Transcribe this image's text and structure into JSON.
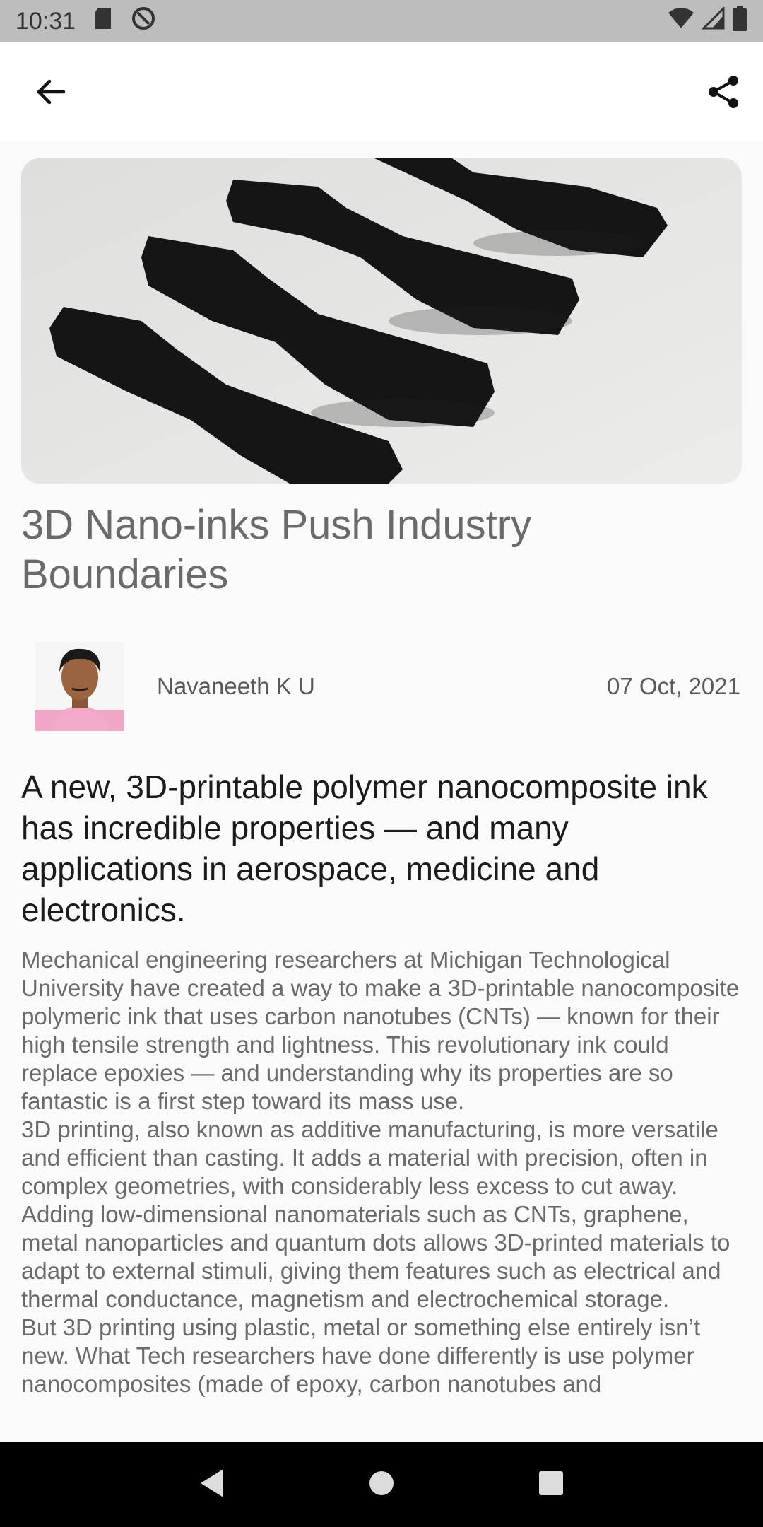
{
  "status_bar": {
    "time": "10:31",
    "icons": [
      "sd-card-icon",
      "sync-icon",
      "wifi-icon",
      "signal-icon",
      "battery-icon"
    ]
  },
  "app_bar": {
    "back_icon": "arrow-left-icon",
    "share_icon": "share-icon"
  },
  "article": {
    "title": "3D Nano-inks Push Industry Boundaries",
    "author": "Navaneeth K U",
    "date": "07 Oct, 2021",
    "headline": "A new, 3D-printable polymer nanocomposite ink has incredible properties — and many applications in aerospace, medicine and electronics.",
    "paragraphs": [
      "Mechanical engineering researchers at Michigan Technological University have created a way to make a 3D-printable nanocomposite polymeric ink that uses carbon nanotubes (CNTs) — known for their high tensile strength and lightness. This revolutionary ink could replace epoxies — and understanding why its properties are so fantastic is a first step toward its mass use.",
      "3D printing, also known as additive manufacturing, is more versatile and efficient than casting. It adds a material with precision, often in complex geometries, with considerably less excess to  cut away. Adding low-dimensional nanomaterials such as CNTs, graphene, metal nanoparticles and quantum dots allows 3D-printed materials to adapt to external stimuli, giving them features such as electrical and thermal conductance, magnetism and electrochemical storage.",
      "But 3D printing using plastic, metal or something else entirely isn’t new. What Tech researchers have done differently is use polymer nanocomposites (made of epoxy, carbon nanotubes and"
    ]
  },
  "nav_bar": {
    "icons": [
      "back-triangle-icon",
      "home-circle-icon",
      "recents-square-icon"
    ]
  },
  "colors": {
    "status_bar_bg": "#bdbdbd",
    "app_bar_bg": "#ffffff",
    "page_bg": "#fafafa",
    "nav_bar_bg": "#000000"
  }
}
